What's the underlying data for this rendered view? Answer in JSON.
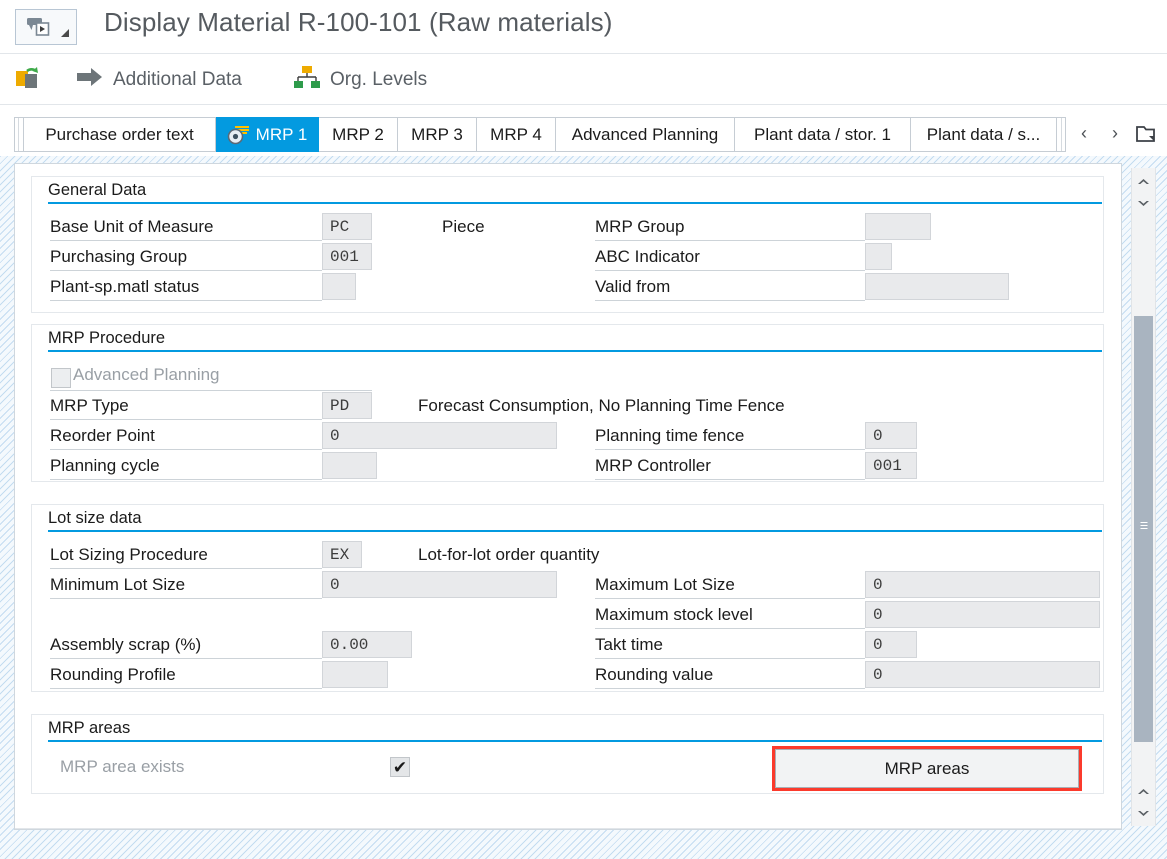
{
  "window": {
    "title": "Display Material R-100-101 (Raw materials)",
    "back_button_icon": "back-navigation-icon",
    "back_button_caret": "dropdown-caret-icon"
  },
  "toolbar": {
    "items": [
      {
        "label": "",
        "icon": "material-copy-icon"
      },
      {
        "label": "Additional Data",
        "icon": "arrow-right-icon"
      },
      {
        "label": "Org. Levels",
        "icon": "org-hierarchy-icon"
      }
    ]
  },
  "tabs": {
    "items": [
      {
        "label": "Purchase order text",
        "selected": false,
        "icon": ""
      },
      {
        "label": "MRP 1",
        "selected": true,
        "icon": "mrp-tab-icon"
      },
      {
        "label": "MRP 2",
        "selected": false,
        "icon": ""
      },
      {
        "label": "MRP 3",
        "selected": false,
        "icon": ""
      },
      {
        "label": "MRP 4",
        "selected": false,
        "icon": ""
      },
      {
        "label": "Advanced Planning",
        "selected": false,
        "icon": ""
      },
      {
        "label": "Plant data / stor. 1",
        "selected": false,
        "icon": ""
      },
      {
        "label": "Plant data / s...",
        "selected": false,
        "icon": ""
      }
    ],
    "nav_prev": "‹",
    "nav_next": "›",
    "overflow_icon": "tab-list-icon"
  },
  "sections": {
    "general_data": {
      "title": "General Data",
      "base_unit_label": "Base Unit of Measure",
      "base_unit_value": "PC",
      "base_unit_text": "Piece",
      "purchasing_group_label": "Purchasing Group",
      "purchasing_group_value": "001",
      "plant_status_label": "Plant-sp.matl status",
      "plant_status_value": "",
      "mrp_group_label": "MRP Group",
      "mrp_group_value": "",
      "abc_indicator_label": "ABC Indicator",
      "abc_indicator_value": "",
      "valid_from_label": "Valid from",
      "valid_from_value": ""
    },
    "mrp_procedure": {
      "title": "MRP Procedure",
      "advanced_planning_label": "Advanced Planning",
      "advanced_planning_checked": false,
      "mrp_type_label": "MRP Type",
      "mrp_type_value": "PD",
      "mrp_type_text": "Forecast Consumption, No Planning Time Fence",
      "reorder_point_label": "Reorder Point",
      "reorder_point_value": "0",
      "planning_cycle_label": "Planning cycle",
      "planning_cycle_value": "",
      "planning_time_fence_label": "Planning time fence",
      "planning_time_fence_value": "0",
      "mrp_controller_label": "MRP Controller",
      "mrp_controller_value": "001"
    },
    "lot_size_data": {
      "title": "Lot size data",
      "lot_sizing_label": "Lot Sizing Procedure",
      "lot_sizing_value": "EX",
      "lot_sizing_text": "Lot-for-lot order quantity",
      "minimum_lot_label": "Minimum Lot Size",
      "minimum_lot_value": "0",
      "assembly_scrap_label": "Assembly scrap (%)",
      "assembly_scrap_value": "0.00",
      "rounding_profile_label": "Rounding Profile",
      "rounding_profile_value": "",
      "maximum_lot_label": "Maximum Lot Size",
      "maximum_lot_value": "0",
      "maximum_stock_label": "Maximum stock level",
      "maximum_stock_value": "0",
      "takt_time_label": "Takt time",
      "takt_time_value": "0",
      "rounding_value_label": "Rounding value",
      "rounding_value_value": "0"
    },
    "mrp_areas": {
      "title": "MRP areas",
      "exists_label": "MRP area exists",
      "exists_checked": true,
      "exists_mark": "✔",
      "button_label": "MRP areas",
      "highlight_color": "#fb3a2c"
    }
  },
  "scrollbar": {
    "up_arrow": "▲",
    "down_arrow": "▼"
  },
  "colors": {
    "accent": "#039ae0",
    "tab_selected_bg": "#039ae0",
    "field_bg": "#e9eaec",
    "highlight": "#fb3a2c"
  }
}
